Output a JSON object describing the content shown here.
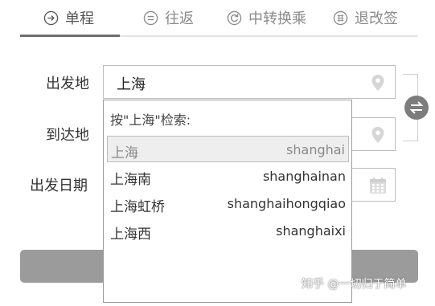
{
  "tabs": [
    {
      "label": "单程",
      "icon": "one-way-icon",
      "active": true
    },
    {
      "label": "往返",
      "icon": "round-trip-icon",
      "active": false
    },
    {
      "label": "中转换乘",
      "icon": "transfer-icon",
      "active": false
    },
    {
      "label": "退改签",
      "icon": "refund-icon",
      "active": false
    }
  ],
  "form": {
    "from_label": "出发地",
    "from_value": "上海",
    "to_label": "到达地",
    "date_label": "出发日期"
  },
  "dropdown": {
    "header": "按\"上海\"检索:",
    "items": [
      {
        "name": "上海",
        "pinyin": "shanghai",
        "selected": true
      },
      {
        "name": "上海南",
        "pinyin": "shanghainan",
        "selected": false
      },
      {
        "name": "上海虹桥",
        "pinyin": "shanghaihongqiao",
        "selected": false
      },
      {
        "name": "上海西",
        "pinyin": "shanghaixi",
        "selected": false
      }
    ]
  },
  "watermark": "知乎 @一切归于简单",
  "colors": {
    "active_tab": "#6e6e6e",
    "submit_button": "#9b9b9b",
    "swap_button": "#7d7d7d",
    "selected_item_bg": "#eeeeee"
  }
}
